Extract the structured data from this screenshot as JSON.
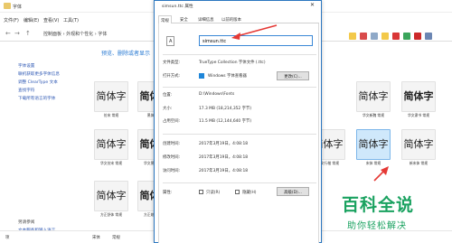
{
  "explorer": {
    "title": "字体",
    "menu": [
      "文件(F)",
      "编辑(E)",
      "查看(V)",
      "工具(T)"
    ],
    "path": "控制面板 › 外观和个性化 › 字体",
    "sidebar": [
      "字体设置",
      "联机获取更多字体信息",
      "调整 ClearType 文本",
      "查找字符",
      "下载所有语言的字体"
    ],
    "sidebar_bottom": [
      "另请参阅",
      "文本服务和输入语言"
    ],
    "heading": "预览、删除或者显示",
    "heading2": "",
    "tiles": [
      {
        "sample": "简体字",
        "caption": "仿宋 常规",
        "bold": false,
        "selected": false
      },
      {
        "sample": "简体字",
        "caption": "黑体 常规",
        "bold": true,
        "selected": false
      },
      {
        "sample": "简体字",
        "caption": "华文仿宋 常规",
        "bold": false,
        "selected": false
      },
      {
        "sample": "简体字",
        "caption": "华文黑体 常规",
        "bold": true,
        "selected": false
      },
      {
        "sample": "简体字",
        "caption": "方正舒体 常规",
        "bold": false,
        "selected": false
      },
      {
        "sample": "简体字",
        "caption": "方正姚体 常规",
        "bold": true,
        "selected": false
      },
      {
        "sample": "简体字",
        "caption": "华文新魏 常规",
        "bold": false,
        "selected": false
      },
      {
        "sample": "简体字",
        "caption": "华文隶书 常规",
        "bold": true,
        "selected": false
      },
      {
        "sample": "简体字",
        "caption": "华文行楷 常规",
        "bold": false,
        "selected": false
      },
      {
        "sample": "简体字",
        "caption": "宋体 常规",
        "bold": false,
        "selected": true
      },
      {
        "sample": "简体字",
        "caption": "新宋体 常规",
        "bold": false,
        "selected": false
      }
    ],
    "status_left": "项",
    "status_items": [
      "宋体",
      "常规"
    ]
  },
  "dialog": {
    "title": "simsun.ttc 属性",
    "close": "✕",
    "tabs": [
      "常规",
      "安全",
      "详细信息",
      "以前的版本"
    ],
    "filename": "simsun.ttc",
    "labels": {
      "type": "文件类型:",
      "opens_with": "打开方式:",
      "location": "位置:",
      "size": "大小:",
      "size_on_disk": "占用空间:",
      "created": "创建时间:",
      "modified": "修改时间:",
      "accessed": "访问时间:",
      "attributes": "属性:"
    },
    "values": {
      "type": "TrueType Collection 字体文件 (.ttc)",
      "opens_with": "Windows 字体查看器",
      "location": "D:\\Windows\\Fonts",
      "size": "17.3 MB (18,214,352 字节)",
      "size_on_disk": "11.5 MB (12,144,640 字节)",
      "created": "2017年3月19日，4:08:18",
      "modified": "2017年3月19日，4:08:18",
      "accessed": "2017年3月19日，4:08:18"
    },
    "change_button": "更改(C)...",
    "readonly_label": "只读(R)",
    "hidden_label": "隐藏(H)",
    "advanced_button": "高级(D)..."
  },
  "watermark": {
    "title": "百科全说",
    "subtitle": "助你轻松解决"
  },
  "colors": {
    "accent": "#2b77c0",
    "watermark": "#1aa260",
    "arrow": "#e53935"
  }
}
